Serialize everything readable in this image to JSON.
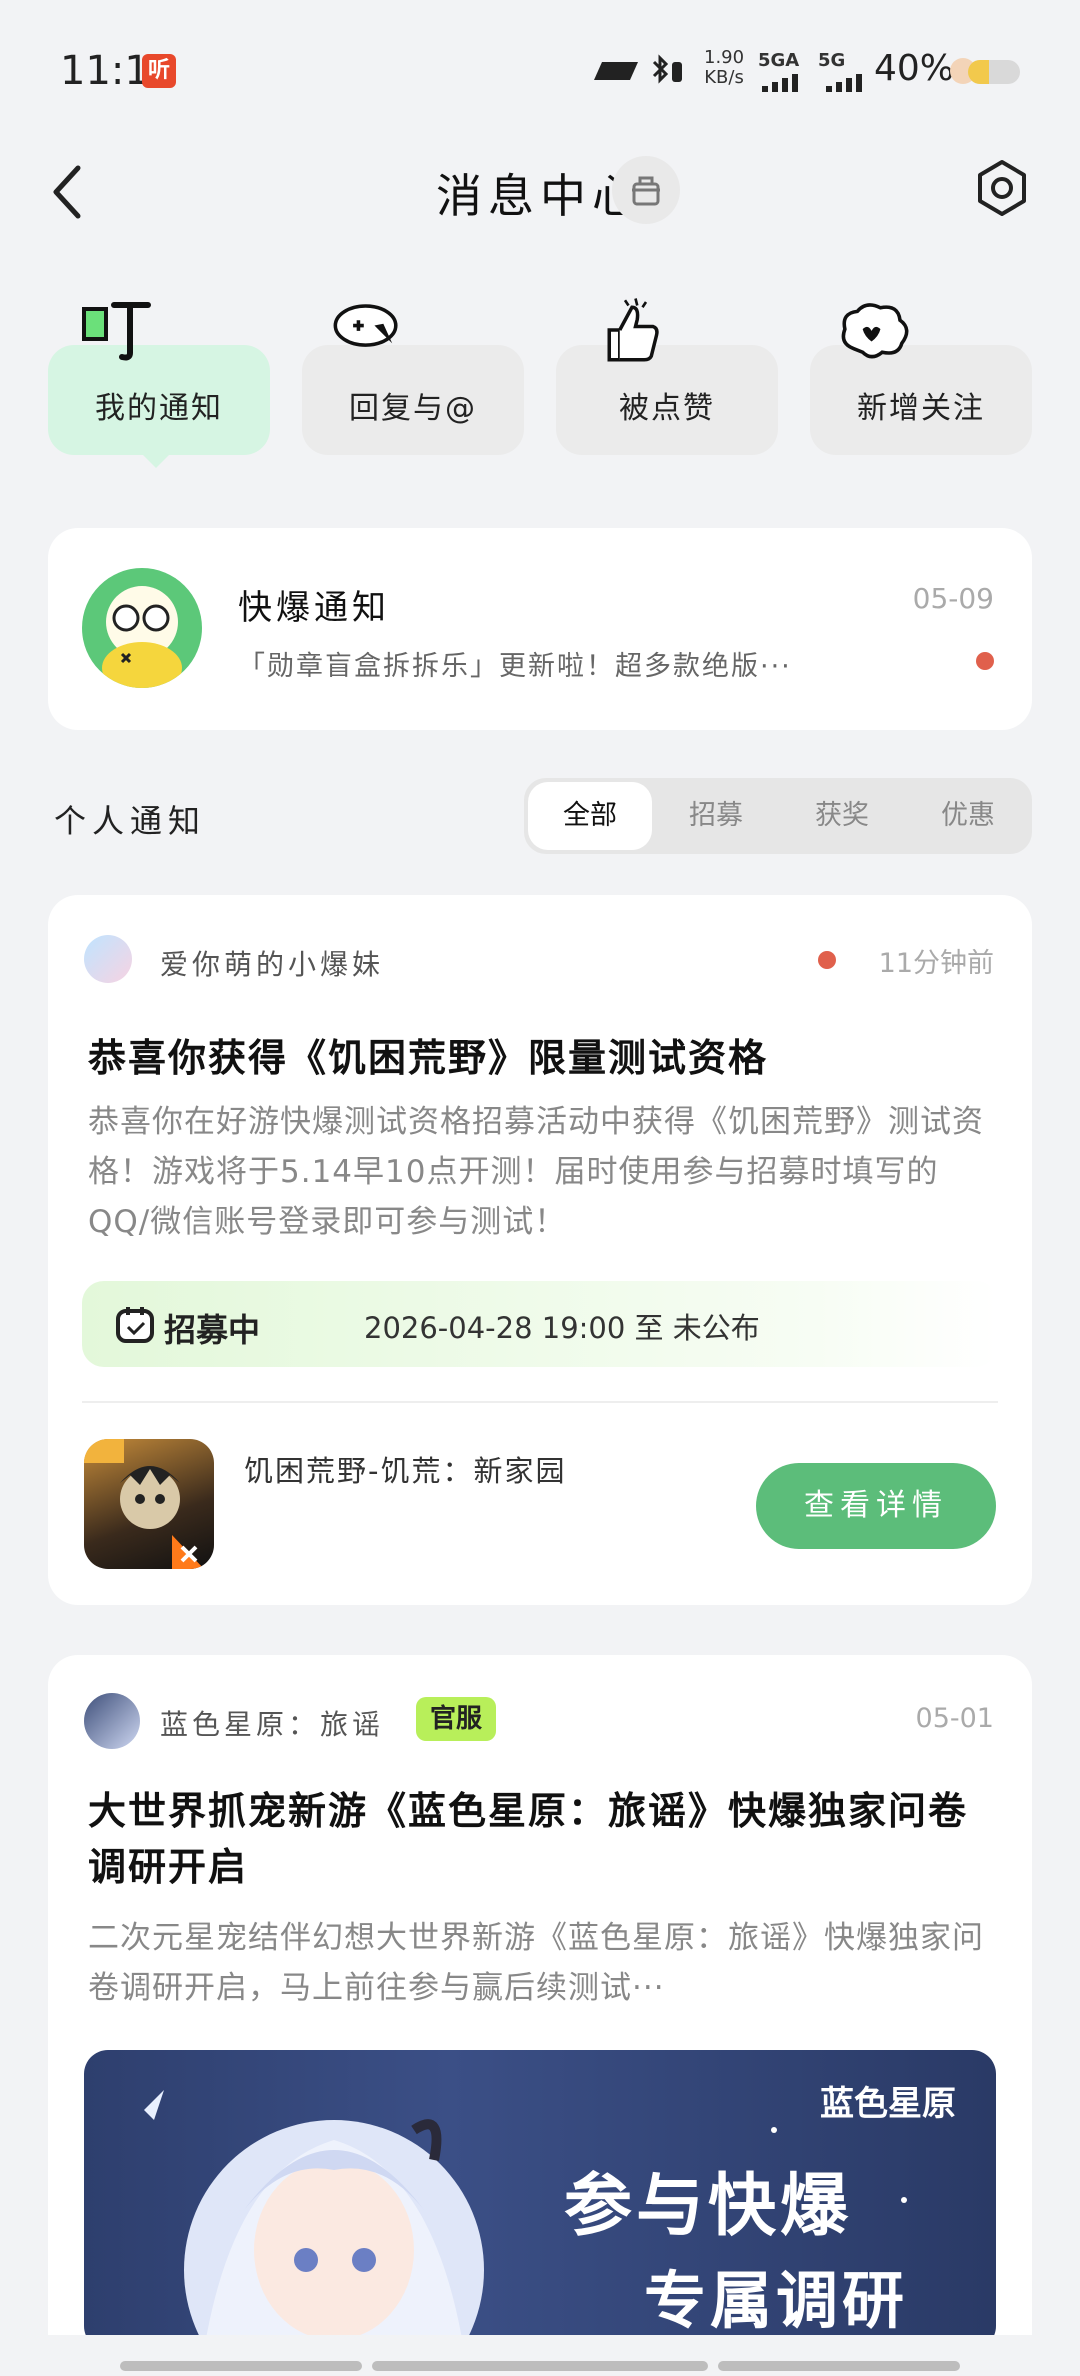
{
  "status_bar": {
    "time": "11:11",
    "listen_badge": "听",
    "net_speed": "1.90",
    "net_unit": "KB/s",
    "sim1": "5GA",
    "sim2": "5G",
    "battery_pct": "40%",
    "battery_level": 0.4
  },
  "header": {
    "title": "消息中心"
  },
  "categories": [
    {
      "label": "我的通知",
      "icon": "notification-icon"
    },
    {
      "label": "回复与@",
      "icon": "reply-icon"
    },
    {
      "label": "被点赞",
      "icon": "thumbs-up-icon"
    },
    {
      "label": "新增关注",
      "icon": "follow-icon"
    }
  ],
  "kuaibao": {
    "title": "快爆通知",
    "date": "05-09",
    "preview": "「勋章盲盒拆拆乐」更新啦！超多款绝版···"
  },
  "personal": {
    "title": "个人通知",
    "filters": [
      "全部",
      "招募",
      "获奖",
      "优惠"
    ]
  },
  "card1": {
    "author": "爱你萌的小爆妹",
    "time": "11分钟前",
    "title": "恭喜你获得《饥困荒野》限量测试资格",
    "body": "恭喜你在好游快爆测试资格招募活动中获得《饥困荒野》测试资格！游戏将于5.14早10点开测！届时使用参与招募时填写的QQ/微信账号登录即可参与测试！",
    "badge": "招募中",
    "date_range": "2026-04-28 19:00 至 未公布",
    "game_name": "饥困荒野-饥荒：新家园",
    "detail_button": "查看详情"
  },
  "card2": {
    "author": "蓝色星原：旅谣",
    "official_tag": "官服",
    "date": "05-01",
    "title": "大世界抓宠新游《蓝色星原：旅谣》快爆独家问卷调研开启",
    "body": "二次元星宠结伴幻想大世界新游《蓝色星原：旅谣》快爆独家问卷调研开启，马上前往参与赢后续测试···",
    "image_brand": "蓝色星原",
    "image_text1": "参与快爆",
    "image_text2": "专属调研"
  }
}
